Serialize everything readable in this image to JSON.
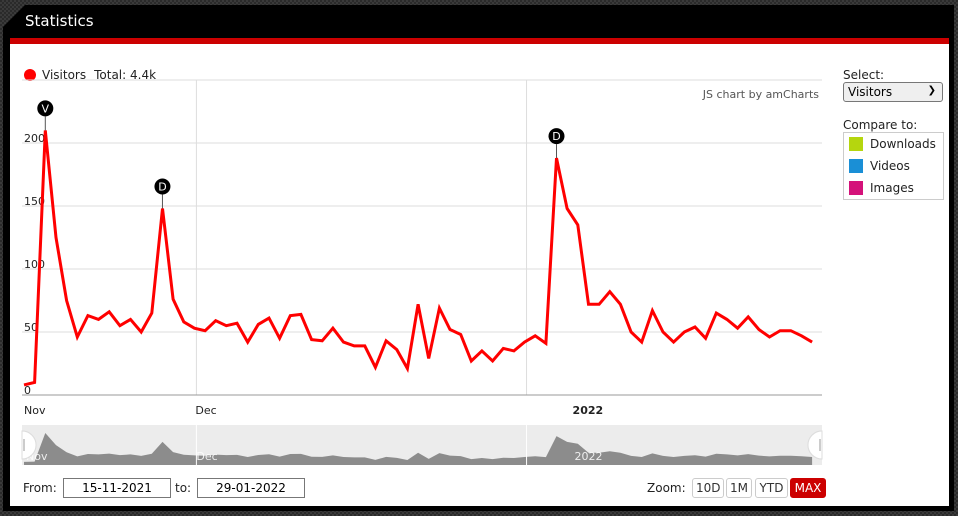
{
  "window": {
    "title": "Statistics"
  },
  "legend": {
    "series_name": "Visitors",
    "total_label": "Total: 4.4k",
    "color": "#ff0000"
  },
  "credit": "JS chart by amCharts",
  "sidebar": {
    "select_label": "Select:",
    "selected": "Visitors",
    "compare_label": "Compare to:",
    "compare_items": [
      {
        "label": "Downloads",
        "color": "#b5d60e"
      },
      {
        "label": "Videos",
        "color": "#1a8fd6"
      },
      {
        "label": "Images",
        "color": "#d4127a"
      }
    ]
  },
  "range": {
    "from_label": "From:",
    "from_value": "15-11-2021",
    "to_label": "to:",
    "to_value": "29-01-2022"
  },
  "zoom": {
    "label": "Zoom:",
    "buttons": [
      "10D",
      "1M",
      "YTD",
      "MAX"
    ],
    "active": "MAX"
  },
  "chart_data": {
    "type": "line",
    "title": "",
    "xlabel": "",
    "ylabel": "",
    "ylim": [
      0,
      230
    ],
    "grid": true,
    "legend_position": "top-left",
    "y_ticks": [
      "0",
      "50",
      "100",
      "150",
      "200"
    ],
    "x_ticks": [
      {
        "label": "Nov",
        "index": 0,
        "bold": false
      },
      {
        "label": "Dec",
        "index": 16,
        "bold": false
      },
      {
        "label": "2022",
        "index": 47,
        "bold": true
      }
    ],
    "series": [
      {
        "name": "Visitors",
        "color": "#ff0000",
        "values": [
          8,
          10,
          210,
          125,
          75,
          46,
          63,
          60,
          66,
          55,
          60,
          50,
          65,
          148,
          76,
          58,
          53,
          51,
          59,
          55,
          57,
          42,
          56,
          61,
          45,
          63,
          64,
          44,
          43,
          53,
          42,
          39,
          39,
          22,
          43,
          36,
          21,
          72,
          29,
          69,
          52,
          48,
          27,
          35,
          27,
          37,
          35,
          42,
          47,
          41,
          188,
          148,
          135,
          72,
          72,
          82,
          72,
          50,
          42,
          67,
          50,
          42,
          50,
          54,
          45,
          65,
          60,
          53,
          62,
          52,
          46,
          51,
          51,
          47,
          42
        ]
      }
    ],
    "event_markers": [
      {
        "letter": "V",
        "index": 2
      },
      {
        "letter": "D",
        "index": 13
      },
      {
        "letter": "D",
        "index": 50
      }
    ],
    "navigator_labels": [
      "Nov",
      "Dec",
      "2022"
    ]
  }
}
